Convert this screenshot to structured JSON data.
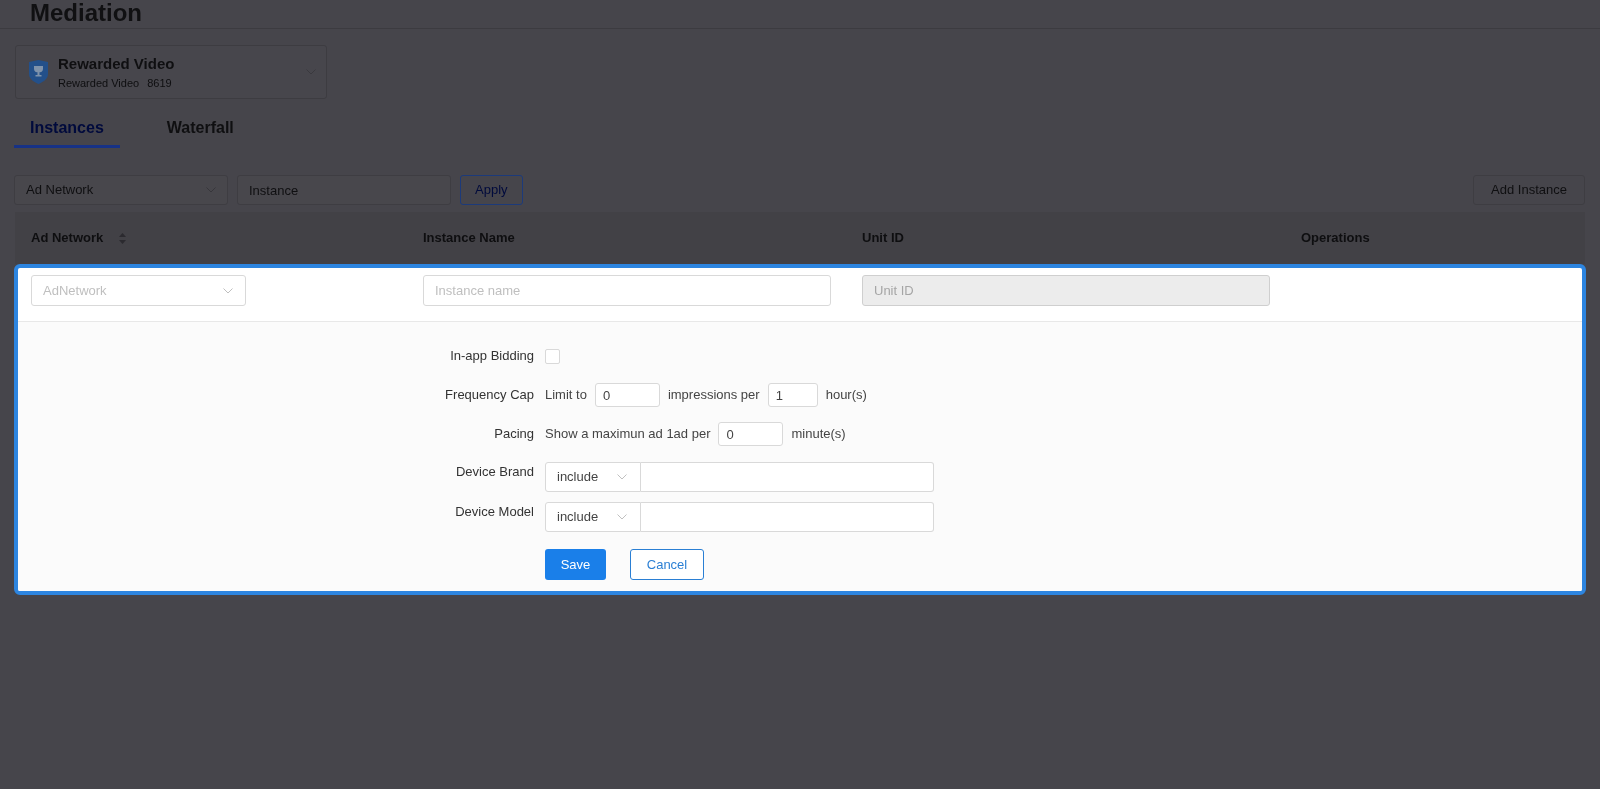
{
  "page": {
    "title": "Mediation"
  },
  "ad_unit": {
    "name": "Rewarded Video",
    "type": "Rewarded Video",
    "id": "8619"
  },
  "tabs": [
    {
      "label": "Instances",
      "selected": true
    },
    {
      "label": "Waterfall",
      "selected": false
    }
  ],
  "filters": {
    "ad_network": {
      "placeholder": "Ad Network"
    },
    "instance": {
      "placeholder": "Instance"
    },
    "apply": "Apply",
    "add_instance": "Add Instance"
  },
  "table": {
    "columns": [
      {
        "label": "Ad Network",
        "sortable": true
      },
      {
        "label": "Instance Name",
        "sortable": false
      },
      {
        "label": "Unit ID",
        "sortable": false
      },
      {
        "label": "Operations",
        "sortable": false
      }
    ]
  },
  "edit_row": {
    "ad_network": {
      "placeholder": "AdNetwork"
    },
    "instance_name": {
      "placeholder": "Instance name",
      "disabled": false
    },
    "unit_id": {
      "placeholder": "Unit ID",
      "disabled": true
    }
  },
  "form": {
    "rows": [
      {
        "kind": "checkbox",
        "label": "In-app Bidding",
        "checked": false
      },
      {
        "kind": "inline",
        "label": "Frequency Cap",
        "parts": [
          {
            "kind": "text",
            "text": "Limit to"
          },
          {
            "kind": "input",
            "value": "0"
          },
          {
            "kind": "text",
            "text": "impressions per"
          },
          {
            "kind": "input",
            "value": "1"
          },
          {
            "kind": "text",
            "text": "hour(s)"
          }
        ]
      },
      {
        "kind": "inline",
        "label": "Pacing",
        "parts": [
          {
            "kind": "text",
            "text": "Show a maximun ad 1ad per"
          },
          {
            "kind": "input",
            "value": "0"
          },
          {
            "kind": "text",
            "text": "minute(s)"
          }
        ]
      },
      {
        "kind": "select_input",
        "label": "Device Brand",
        "select": "include"
      },
      {
        "kind": "select_input",
        "label": "Device Model",
        "select": "include"
      }
    ],
    "buttons": [
      {
        "label": "Save",
        "kind": "primary"
      },
      {
        "label": "Cancel",
        "kind": "secondary"
      }
    ]
  }
}
